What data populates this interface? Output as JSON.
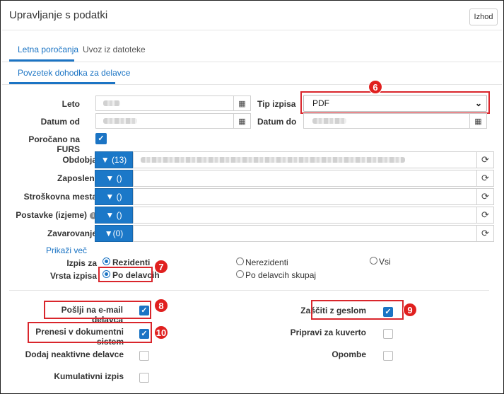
{
  "window": {
    "title": "Upravljanje s podatki",
    "exit_label": "Izhod"
  },
  "tabs": [
    {
      "label": "Letna poročanja",
      "active": true
    },
    {
      "label": "Uvoz iz datoteke",
      "active": false
    }
  ],
  "subtab": {
    "label": "Povzetek dohodka za delavce"
  },
  "form": {
    "leto_label": "Leto",
    "datum_od_label": "Datum od",
    "porocano_furs_label": "Poročano na FURS",
    "porocano_furs_checked": true,
    "tip_izpisa_label": "Tip izpisa",
    "tip_izpisa_value": "PDF",
    "datum_do_label": "Datum do"
  },
  "filters": [
    {
      "label": "Obdobja",
      "button": "(13)"
    },
    {
      "label": "Zaposleni",
      "button": "()"
    },
    {
      "label": "Stroškovna mesta",
      "button": "()"
    },
    {
      "label": "Postavke (izjeme)",
      "button": "()",
      "info_icon": true
    },
    {
      "label": "Zavarovanje",
      "button": "(0)"
    }
  ],
  "prikazi_vec": "Prikaži več",
  "izpis_za": {
    "label": "Izpis za",
    "options": [
      "Rezidenti",
      "Nerezidenti",
      "Vsi"
    ],
    "selected": "Rezidenti"
  },
  "vrsta_izpisa": {
    "label": "Vrsta izpisa",
    "options": [
      "Po delavcih",
      "Po delavcih skupaj"
    ],
    "selected": "Po delavcih"
  },
  "options_left": [
    {
      "label": "Pošlji na e-mail delavca",
      "checked": true
    },
    {
      "label": "Prenesi v dokumentni sistem",
      "checked": true
    },
    {
      "label": "Dodaj neaktivne delavce",
      "checked": false
    },
    {
      "label": "Kumulativni izpis",
      "checked": false
    }
  ],
  "options_right": [
    {
      "label": "Zaščiti z geslom",
      "checked": true
    },
    {
      "label": "Pripravi za kuverto",
      "checked": false
    },
    {
      "label": "Opombe",
      "checked": false
    }
  ],
  "annotations": [
    "6",
    "7",
    "8",
    "9",
    "10"
  ],
  "colors": {
    "accent": "#1b74c4",
    "button": "#1b78c8",
    "annotation_red": "#d9262c"
  }
}
